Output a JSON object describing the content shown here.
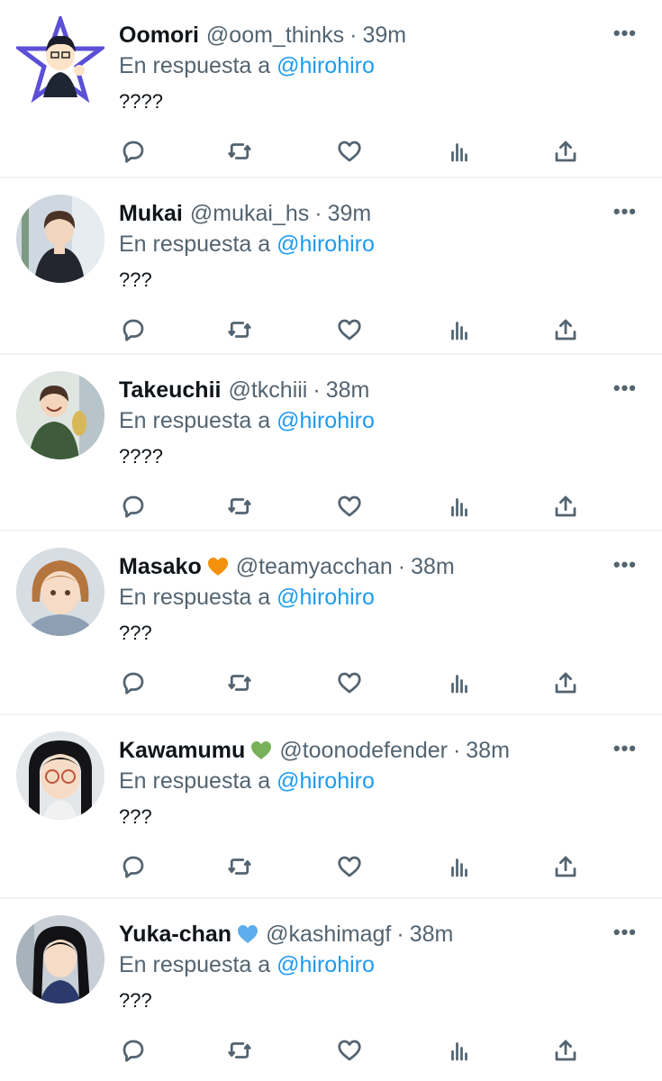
{
  "replies": [
    {
      "name": "Oomori",
      "emoji": "",
      "handle": "@oom_thinks",
      "time": "39m",
      "replying_prefix": "En respuesta a",
      "mention": "@hirohiro",
      "text": "????",
      "avatar": "star-boy-icon"
    },
    {
      "name": "Mukai",
      "emoji": "",
      "handle": "@mukai_hs",
      "time": "39m",
      "replying_prefix": "En respuesta a",
      "mention": "@hirohiro",
      "text": "???",
      "avatar": "dark-hair-boy-icon"
    },
    {
      "name": "Takeuchii",
      "emoji": "",
      "handle": "@tkchiii",
      "time": "38m",
      "replying_prefix": "En respuesta a",
      "mention": "@hirohiro",
      "text": "????",
      "avatar": "laughing-boy-icon"
    },
    {
      "name": "Masako",
      "emoji": "orange-heart",
      "handle": "@teamyacchan",
      "time": "38m",
      "replying_prefix": "En respuesta a",
      "mention": "@hirohiro",
      "text": "???",
      "avatar": "bob-hair-girl-icon"
    },
    {
      "name": "Kawamumu",
      "emoji": "green-heart",
      "handle": "@toonodefender",
      "time": "38m",
      "replying_prefix": "En respuesta a",
      "mention": "@hirohiro",
      "text": "???",
      "avatar": "glasses-girl-icon"
    },
    {
      "name": "Yuka-chan",
      "emoji": "blue-heart",
      "handle": "@kashimagf",
      "time": "38m",
      "replying_prefix": "En respuesta a",
      "mention": "@hirohiro",
      "text": "???",
      "avatar": "long-hair-girl-icon"
    }
  ],
  "separator": "·",
  "more_label": "•••",
  "colors": {
    "mention": "#1d9bf0",
    "secondary_text": "#536471",
    "orange_heart": "#f4900c",
    "green_heart": "#78b159",
    "blue_heart": "#5dadec"
  }
}
